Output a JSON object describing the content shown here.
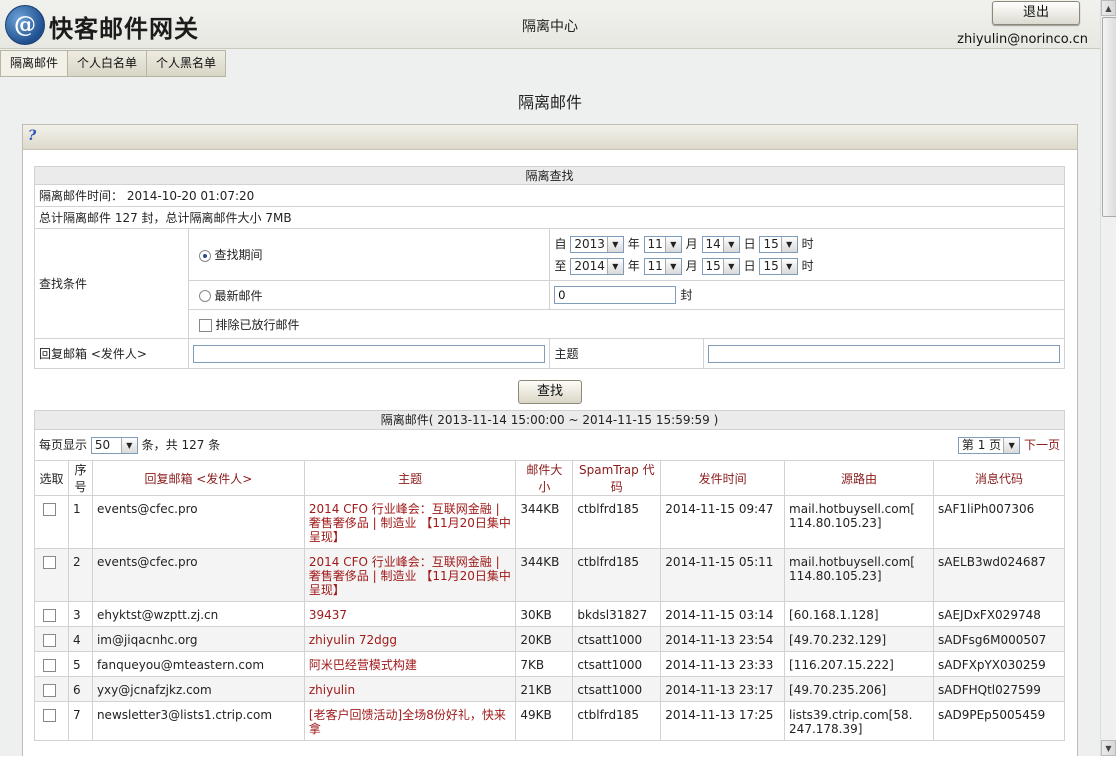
{
  "header": {
    "logo_glyph": "@",
    "app_name": "快客邮件网关",
    "center_title": "隔离中心",
    "logout_label": "退出",
    "user_email": "zhiyulin@norinco.cn"
  },
  "tabs": [
    {
      "label": "隔离邮件",
      "active": true
    },
    {
      "label": "个人白名单",
      "active": false
    },
    {
      "label": "个人黑名单",
      "active": false
    }
  ],
  "page_title": "隔离邮件",
  "help_glyph": "?",
  "search": {
    "section_title": "隔离查找",
    "quarantine_time_label": "隔离邮件时间：",
    "quarantine_time": "2014-10-20 01:07:20",
    "totals": "总计隔离邮件 127 封，总计隔离邮件大小 7MB",
    "condition_label": "查找条件",
    "period_option": "查找期间",
    "latest_option": "最新邮件",
    "exclude_label": "排除已放行邮件",
    "from_prefix": "自",
    "to_prefix": "至",
    "year_unit": "年",
    "month_unit": "月",
    "day_unit": "日",
    "hour_unit": "时",
    "from": {
      "year": "2013",
      "month": "11",
      "day": "14",
      "hour": "15"
    },
    "to": {
      "year": "2014",
      "month": "11",
      "day": "15",
      "hour": "15"
    },
    "latest_count": "0",
    "latest_unit": "封",
    "reply_label": "回复邮箱 <发件人>",
    "subject_label": "主题",
    "reply_value": "",
    "subject_value": "",
    "search_button": "查找"
  },
  "results": {
    "title": "隔离邮件( 2013-11-14 15:00:00 ~ 2014-11-15 15:59:59 )",
    "per_page_label": "每页显示",
    "per_page": "50",
    "count_text": "条，共 127 条",
    "page_select": "第 1 页",
    "next_page": "下一页",
    "columns": {
      "pick": "选取",
      "seq": "序号",
      "sender": "回复邮箱 <发件人>",
      "subject": "主题",
      "size": "邮件大小",
      "spamtrap": "SpamTrap 代码",
      "time": "发件时间",
      "route": "源路由",
      "msgid": "消息代码"
    },
    "rows": [
      {
        "seq": "1",
        "sender": "events@cfec.pro",
        "subject": "2014 CFO 行业峰会：互联网金融 | 奢售奢侈品 | 制造业 【11月20日集中呈现】",
        "size": "344KB",
        "spamtrap": "ctblfrd185",
        "time": "2014-11-15 09:47",
        "route": "mail.hotbuysell.com[ 114.80.105.23]",
        "msgid": "sAF1liPh007306"
      },
      {
        "seq": "2",
        "sender": "events@cfec.pro",
        "subject": "2014 CFO 行业峰会：互联网金融 | 奢售奢侈品 | 制造业 【11月20日集中呈现】",
        "size": "344KB",
        "spamtrap": "ctblfrd185",
        "time": "2014-11-15 05:11",
        "route": "mail.hotbuysell.com[ 114.80.105.23]",
        "msgid": "sAELB3wd024687"
      },
      {
        "seq": "3",
        "sender": "ehyktst@wzptt.zj.cn",
        "subject": "39437",
        "size": "30KB",
        "spamtrap": "bkdsl31827",
        "time": "2014-11-15 03:14",
        "route": "[60.168.1.128]",
        "msgid": "sAEJDxFX029748"
      },
      {
        "seq": "4",
        "sender": "im@jiqacnhc.org",
        "subject": "zhiyulin 72dgg",
        "size": "20KB",
        "spamtrap": "ctsatt1000",
        "time": "2014-11-13 23:54",
        "route": "[49.70.232.129]",
        "msgid": "sADFsg6M000507"
      },
      {
        "seq": "5",
        "sender": "fanqueyou@mteastern.com",
        "subject": "阿米巴经营模式构建",
        "size": "7KB",
        "spamtrap": "ctsatt1000",
        "time": "2014-11-13 23:33",
        "route": "[116.207.15.222]",
        "msgid": "sADFXpYX030259"
      },
      {
        "seq": "6",
        "sender": "yxy@jcnafzjkz.com",
        "subject": "zhiyulin",
        "size": "21KB",
        "spamtrap": "ctsatt1000",
        "time": "2014-11-13 23:17",
        "route": "[49.70.235.206]",
        "msgid": "sADFHQtl027599"
      },
      {
        "seq": "7",
        "sender": "newsletter3@lists1.ctrip.com",
        "subject": "[老客户回馈活动]全场8份好礼，快来拿",
        "size": "49KB",
        "spamtrap": "ctblfrd185",
        "time": "2014-11-13 17:25",
        "route": "lists39.ctrip.com[58. 247.178.39]",
        "msgid": "sAD9PEp5005459"
      }
    ]
  }
}
